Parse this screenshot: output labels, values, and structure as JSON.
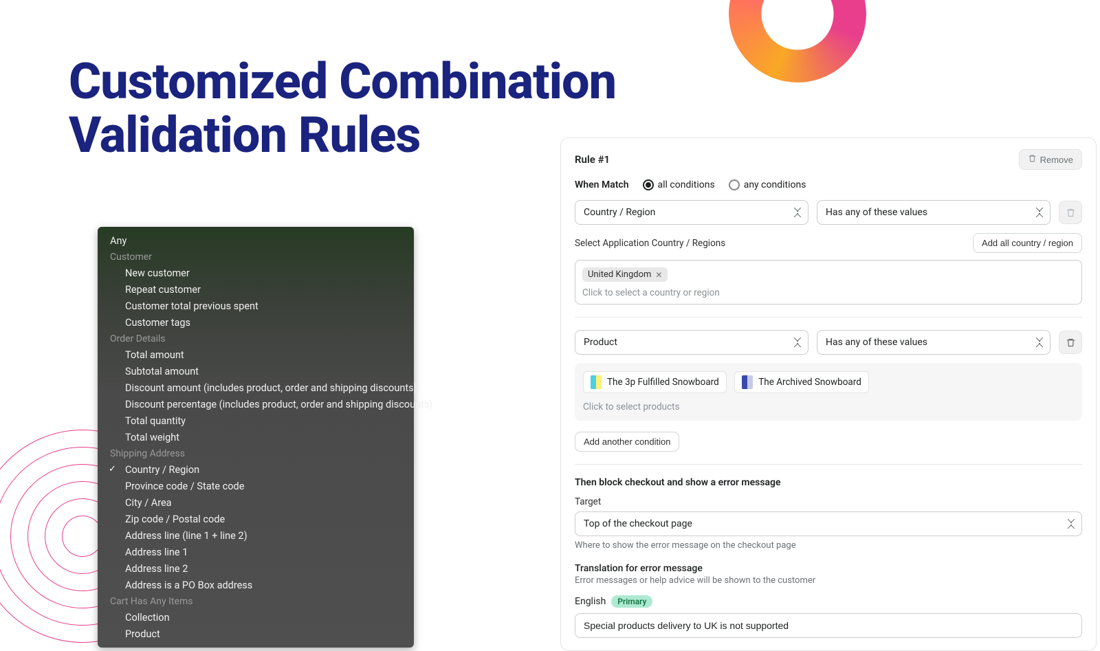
{
  "page_title": "Customized Combination Validation Rules",
  "dropdown": {
    "any_label": "Any",
    "groups": [
      {
        "header": "Customer",
        "items": [
          "New customer",
          "Repeat customer",
          "Customer total previous spent",
          "Customer tags"
        ]
      },
      {
        "header": "Order Details",
        "items": [
          "Total amount",
          "Subtotal amount",
          "Discount amount (includes product, order and shipping discounts)",
          "Discount percentage (includes product, order and shipping discounts)",
          "Total quantity",
          "Total weight"
        ]
      },
      {
        "header": "Shipping Address",
        "items": [
          "Country / Region",
          "Province code / State code",
          "City / Area",
          "Zip code / Postal code",
          "Address line (line 1 + line 2)",
          "Address line 1",
          "Address line 2",
          "Address is a PO Box address"
        ],
        "checked_index": 0
      },
      {
        "header": "Cart Has Any Items",
        "items": [
          "Collection",
          "Product"
        ]
      }
    ]
  },
  "rule": {
    "title": "Rule #1",
    "remove_label": "Remove",
    "when_match_label": "When Match",
    "radio_all": "all conditions",
    "radio_any": "any conditions",
    "cond1": {
      "field": "Country / Region",
      "op": "Has any of these values"
    },
    "country_section_label": "Select Application Country / Regions",
    "add_all_countries_label": "Add all country / region",
    "selected_country": "United Kingdom",
    "country_placeholder": "Click to select a country or region",
    "cond2": {
      "field": "Product",
      "op": "Has any of these values"
    },
    "products": [
      "The 3p Fulfilled Snowboard",
      "The Archived Snowboard"
    ],
    "product_placeholder": "Click to select products",
    "add_condition_label": "Add another condition",
    "then_label": "Then block checkout and show a error message",
    "target_label": "Target",
    "target_value": "Top of the checkout page",
    "target_help": "Where to show the error message on the checkout page",
    "translation_label": "Translation for error message",
    "translation_help": "Error messages or help advice will be shown to the customer",
    "lang_label": "English",
    "primary_badge": "Primary",
    "error_message_value": "Special products delivery to UK is not supported"
  }
}
